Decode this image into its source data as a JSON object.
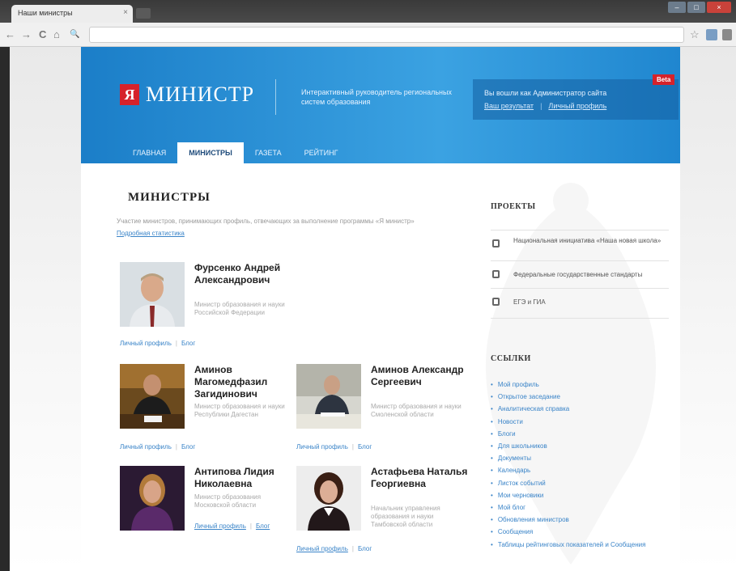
{
  "browser": {
    "tab_title": "Наши министры",
    "tab_close": "×",
    "nav_back": "←",
    "nav_forward": "→",
    "nav_reload": "C",
    "nav_home": "⌂",
    "address_icon": "🔍",
    "bookmark_star": "☆",
    "window_controls": {
      "minimize": "–",
      "maximize": "□",
      "close": "×"
    }
  },
  "header": {
    "logo_letter": "Я",
    "logo_text": "МИНИСТР",
    "tagline": "Интерактивный руководитель региональных систем образования",
    "beta_badge": "Beta",
    "login_text": "Вы вошли как Администратор сайта",
    "login_link": "Ваш результат",
    "login_separator": "|",
    "profile_link": "Личный профиль"
  },
  "nav": [
    {
      "label": "ГЛАВНАЯ",
      "active": false
    },
    {
      "label": "МИНИСТРЫ",
      "active": true
    },
    {
      "label": "ГАЗЕТА",
      "active": false
    },
    {
      "label": "РЕЙТИНГ",
      "active": false
    }
  ],
  "main": {
    "title": "МИНИСТРЫ",
    "intro": "Участие министров, принимающих профиль, отвечающих за выполнение программы «Я министр»",
    "intro_link": "Подробная статистика",
    "link_separator": "|",
    "ministers": [
      {
        "name": "Фурсенко Андрей Александрович",
        "role": "Министр образования и науки Российской Федерации",
        "link_profile": "Личный профиль",
        "link_blog": "Блог"
      },
      {
        "name": "Аминов Магомедфазил Загидинович",
        "role": "Министр образования и науки Республики Дагестан",
        "link_profile": "Личный профиль",
        "link_blog": "Блог"
      },
      {
        "name": "Аминов Александр Сергеевич",
        "role": "Министр образования и науки Смоленской области",
        "link_profile": "Личный профиль",
        "link_blog": "Блог"
      },
      {
        "name": "Антипова Лидия Николаевна",
        "role": "Министр образования Московской области",
        "link_profile": "Личный профиль",
        "link_blog": "Блог"
      },
      {
        "name": "Астафьева Наталья Георгиевна",
        "role": "Начальник управления образования и науки Тамбовской области",
        "link_profile": "Личный профиль",
        "link_blog": "Блог"
      }
    ]
  },
  "sidebar": {
    "projects_title": "ПРОЕКТЫ",
    "projects": [
      {
        "label": "Национальная инициатива «Наша новая школа»"
      },
      {
        "label": "Федеральные государственные стандарты"
      },
      {
        "label": "ЕГЭ и ГИА"
      }
    ],
    "links_title": "ССЫЛКИ",
    "links": [
      "Мой профиль",
      "Открытое заседание",
      "Аналитическая справка",
      "Новости",
      "Блоги",
      "Для школьников",
      "Документы",
      "Календарь",
      "Листок событий",
      "Мои черновики",
      "Мой блог",
      "Обновления министров",
      "Сообщения",
      "Таблицы рейтинговых показателей и Сообщения"
    ]
  },
  "colors": {
    "header_blue": "#2a90d6",
    "logo_red": "#d6222a",
    "link_blue": "#3a84c8"
  }
}
